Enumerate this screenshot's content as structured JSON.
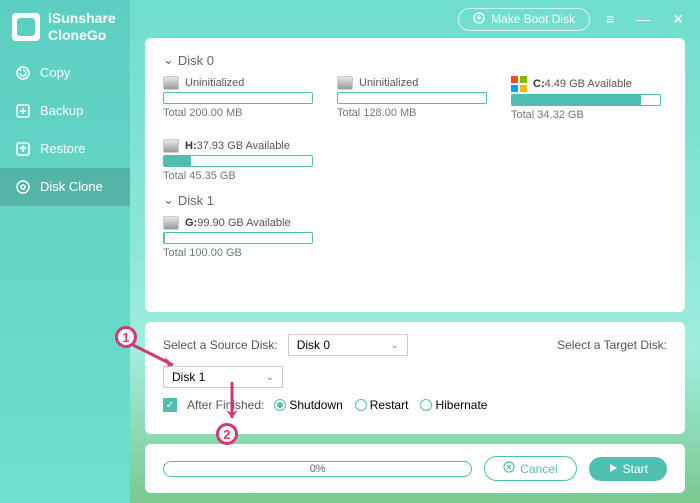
{
  "app": {
    "title_line1": "iSunshare",
    "title_line2": "CloneGo"
  },
  "sidebar": {
    "items": [
      {
        "label": "Copy"
      },
      {
        "label": "Backup"
      },
      {
        "label": "Restore"
      },
      {
        "label": "Disk Clone"
      }
    ]
  },
  "topbar": {
    "boot_label": "Make Boot Disk"
  },
  "disks": [
    {
      "name": "Disk 0",
      "volumes": [
        {
          "label": "Uninitialized",
          "total": "Total 200.00 MB",
          "fill": 0,
          "system": false,
          "letter": ""
        },
        {
          "label": "Uninitialized",
          "total": "Total 128.00 MB",
          "fill": 0,
          "system": false,
          "letter": ""
        },
        {
          "label": "4.49 GB Available",
          "total": "Total 34.32 GB",
          "fill": 87,
          "system": true,
          "letter": "C:"
        },
        {
          "label": "37.93 GB Available",
          "total": "Total 45.35 GB",
          "fill": 18,
          "system": false,
          "letter": "H:"
        }
      ]
    },
    {
      "name": "Disk 1",
      "volumes": [
        {
          "label": "99.90 GB Available",
          "total": "Total 100.00 GB",
          "fill": 1,
          "system": false,
          "letter": "G:"
        }
      ]
    }
  ],
  "controls": {
    "source_label": "Select a Source Disk:",
    "source_value": "Disk 0",
    "target_label": "Select a Target Disk:",
    "target_value": "Disk 1",
    "after_label": "After Finished:",
    "after_checked": true,
    "options": [
      {
        "label": "Shutdown",
        "selected": true
      },
      {
        "label": "Restart",
        "selected": false
      },
      {
        "label": "Hibernate",
        "selected": false
      }
    ]
  },
  "progress": {
    "percent": "0%"
  },
  "buttons": {
    "cancel": "Cancel",
    "start": "Start"
  },
  "annotations": {
    "one": "1",
    "two": "2"
  }
}
